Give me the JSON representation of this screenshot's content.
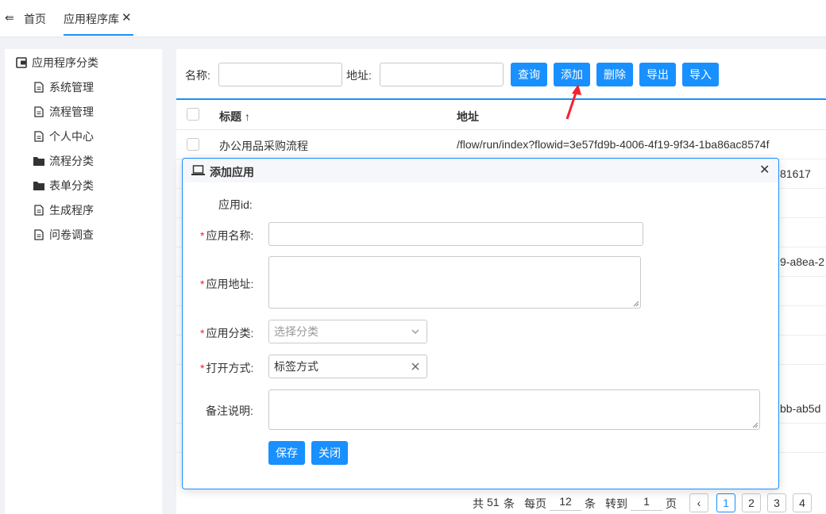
{
  "topbar": {
    "back_icon": "menu-fold-icon",
    "home_label": "首页",
    "active_tab": "应用程序库",
    "close_glyph": "✕"
  },
  "sidebar": {
    "root": {
      "label": "应用程序分类",
      "icon": "wallet-icon"
    },
    "items": [
      {
        "label": "系统管理",
        "icon": "file-icon"
      },
      {
        "label": "流程管理",
        "icon": "file-icon"
      },
      {
        "label": "个人中心",
        "icon": "file-icon"
      },
      {
        "label": "流程分类",
        "icon": "folder-icon"
      },
      {
        "label": "表单分类",
        "icon": "folder-icon"
      },
      {
        "label": "生成程序",
        "icon": "file-icon"
      },
      {
        "label": "问卷调查",
        "icon": "file-icon"
      }
    ]
  },
  "search": {
    "name_label": "名称:",
    "address_label": "地址:",
    "name_value": "",
    "address_value": ""
  },
  "toolbar": {
    "query": "查询",
    "add": "添加",
    "delete": "删除",
    "export": "导出",
    "import": "导入"
  },
  "table": {
    "columns": [
      "标题 ↑",
      "地址"
    ],
    "rows": [
      {
        "title": "办公用品采购流程",
        "address": "/flow/run/index?flowid=3e57fd9b-4006-4f19-9f34-1ba86ac8574f"
      },
      {
        "title": "",
        "address": "81617"
      },
      {
        "title": "",
        "address": ""
      },
      {
        "title": "",
        "address": ""
      },
      {
        "title": "",
        "address": "9-a8ea-2"
      },
      {
        "title": "",
        "address": ""
      },
      {
        "title": "",
        "address": ""
      },
      {
        "title": "",
        "address": ""
      },
      {
        "title": "",
        "address": "bb-ab5d"
      },
      {
        "title": "",
        "address": ""
      }
    ]
  },
  "pagination": {
    "total_prefix": "共",
    "total": "51",
    "total_suffix": "条",
    "per_page_label": "每页",
    "per_page": "12",
    "per_page_suffix": "条",
    "goto_label": "转到",
    "goto_value": "1",
    "goto_suffix": "页",
    "pages": [
      "1",
      "2",
      "3",
      "4"
    ],
    "current": "1",
    "prev_glyph": "‹"
  },
  "dialog": {
    "icon": "laptop-icon",
    "title": "添加应用",
    "close_glyph": "✕",
    "fields": {
      "app_id_label": "应用id:",
      "app_name_label": "应用名称:",
      "app_address_label": "应用地址:",
      "app_category_label": "应用分类:",
      "app_category_placeholder": "选择分类",
      "open_mode_label": "打开方式:",
      "open_mode_value": "标签方式",
      "remark_label": "备注说明:"
    },
    "required_mark": "*",
    "save": "保存",
    "close": "关闭"
  },
  "colors": {
    "primary": "#1890ff",
    "required": "#f5222d",
    "annotation_arrow": "#f5222d"
  }
}
